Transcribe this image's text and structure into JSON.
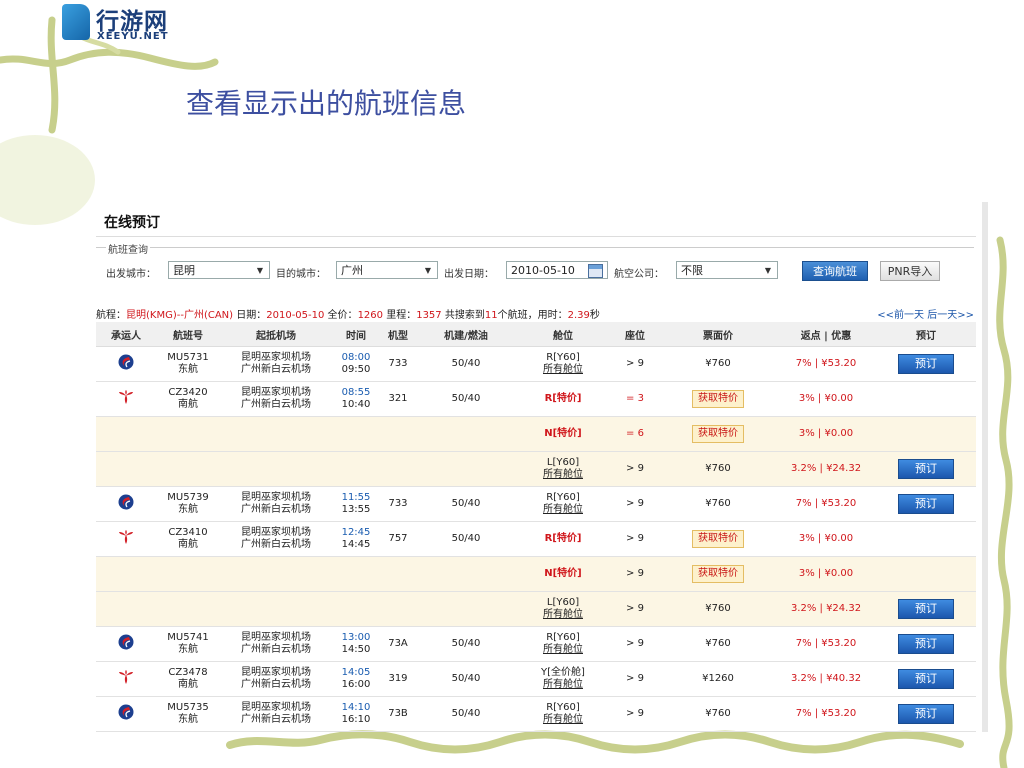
{
  "brand": {
    "name_cn": "行游网",
    "name_en": "XEEYU.NET"
  },
  "slide_title": "查看显示出的航班信息",
  "panel": {
    "title": "在线预订",
    "legend": "航班查询",
    "form": {
      "dep_label": "出发城市：",
      "dep_value": "昆明",
      "arr_label": "目的城市：",
      "arr_value": "广州",
      "date_label": "出发日期：",
      "date_value": "2010-05-10",
      "airline_label": "航空公司：",
      "airline_value": "不限",
      "search_btn": "查询航班",
      "pnr_btn": "PNR导入"
    },
    "info": {
      "p1": "航程：",
      "route": "昆明(KMG)--广州(CAN)",
      "p2": " 日期：",
      "date": "2010-05-10",
      "p3": " 全价：",
      "full": "1260",
      "p4": " 里程：",
      "miles": "1357",
      "p5": " 共搜索到",
      "count": "11",
      "p6": "个航班，用时：",
      "time": "2.39",
      "p7": "秒"
    },
    "daynav": "<<前一天  后一天>>",
    "headers": [
      "承运人",
      "航班号",
      "起抵机场",
      "时间",
      "机型",
      "机建/燃油",
      "舱位",
      "座位",
      "票面价",
      "返点 | 优惠",
      "预订"
    ],
    "rows": [
      {
        "sub": false,
        "carrier": "ce",
        "flight": "MU5731",
        "airline": "东航",
        "dep_ap": "昆明巫家坝机场",
        "arr_ap": "广州新白云机场",
        "dep_t": "08:00",
        "arr_t": "09:50",
        "plane": "733",
        "tax": "50/40",
        "cabin1": "R[Y60]",
        "cabin2": "所有舱位",
        "special": false,
        "seat": "> 9",
        "price": "¥760",
        "price_special": false,
        "rebate": "7% | ¥53.20",
        "book": "预订"
      },
      {
        "sub": false,
        "carrier": "cs",
        "flight": "CZ3420",
        "airline": "南航",
        "dep_ap": "昆明巫家坝机场",
        "arr_ap": "广州新白云机场",
        "dep_t": "08:55",
        "arr_t": "10:40",
        "plane": "321",
        "tax": "50/40",
        "cabin1": "R[特价]",
        "cabin2": "",
        "special": true,
        "seat": "= 3",
        "seat_red": true,
        "price": "获取特价",
        "price_special": true,
        "rebate": "3% | ¥0.00",
        "book": ""
      },
      {
        "sub": true,
        "carrier": "",
        "flight": "",
        "airline": "",
        "dep_ap": "",
        "arr_ap": "",
        "dep_t": "",
        "arr_t": "",
        "plane": "",
        "tax": "",
        "cabin1": "N[特价]",
        "cabin2": "",
        "special": true,
        "seat": "= 6",
        "seat_red": true,
        "price": "获取特价",
        "price_special": true,
        "rebate": "3% | ¥0.00",
        "book": ""
      },
      {
        "sub": true,
        "carrier": "",
        "flight": "",
        "airline": "",
        "dep_ap": "",
        "arr_ap": "",
        "dep_t": "",
        "arr_t": "",
        "plane": "",
        "tax": "",
        "cabin1": "L[Y60]",
        "cabin2": "所有舱位",
        "special": false,
        "seat": "> 9",
        "price": "¥760",
        "price_special": false,
        "rebate": "3.2% | ¥24.32",
        "book": "预订"
      },
      {
        "sub": false,
        "carrier": "ce",
        "flight": "MU5739",
        "airline": "东航",
        "dep_ap": "昆明巫家坝机场",
        "arr_ap": "广州新白云机场",
        "dep_t": "11:55",
        "arr_t": "13:55",
        "plane": "733",
        "tax": "50/40",
        "cabin1": "R[Y60]",
        "cabin2": "所有舱位",
        "special": false,
        "seat": "> 9",
        "price": "¥760",
        "price_special": false,
        "rebate": "7% | ¥53.20",
        "book": "预订"
      },
      {
        "sub": false,
        "carrier": "cs",
        "flight": "CZ3410",
        "airline": "南航",
        "dep_ap": "昆明巫家坝机场",
        "arr_ap": "广州新白云机场",
        "dep_t": "12:45",
        "arr_t": "14:45",
        "plane": "757",
        "tax": "50/40",
        "cabin1": "R[特价]",
        "cabin2": "",
        "special": true,
        "seat": "> 9",
        "price": "获取特价",
        "price_special": true,
        "rebate": "3% | ¥0.00",
        "book": ""
      },
      {
        "sub": true,
        "carrier": "",
        "flight": "",
        "airline": "",
        "dep_ap": "",
        "arr_ap": "",
        "dep_t": "",
        "arr_t": "",
        "plane": "",
        "tax": "",
        "cabin1": "N[特价]",
        "cabin2": "",
        "special": true,
        "seat": "> 9",
        "price": "获取特价",
        "price_special": true,
        "rebate": "3% | ¥0.00",
        "book": ""
      },
      {
        "sub": true,
        "carrier": "",
        "flight": "",
        "airline": "",
        "dep_ap": "",
        "arr_ap": "",
        "dep_t": "",
        "arr_t": "",
        "plane": "",
        "tax": "",
        "cabin1": "L[Y60]",
        "cabin2": "所有舱位",
        "special": false,
        "seat": "> 9",
        "price": "¥760",
        "price_special": false,
        "rebate": "3.2% | ¥24.32",
        "book": "预订"
      },
      {
        "sub": false,
        "carrier": "ce",
        "flight": "MU5741",
        "airline": "东航",
        "dep_ap": "昆明巫家坝机场",
        "arr_ap": "广州新白云机场",
        "dep_t": "13:00",
        "arr_t": "14:50",
        "plane": "73A",
        "tax": "50/40",
        "cabin1": "R[Y60]",
        "cabin2": "所有舱位",
        "special": false,
        "seat": "> 9",
        "price": "¥760",
        "price_special": false,
        "rebate": "7% | ¥53.20",
        "book": "预订"
      },
      {
        "sub": false,
        "carrier": "cs",
        "flight": "CZ3478",
        "airline": "南航",
        "dep_ap": "昆明巫家坝机场",
        "arr_ap": "广州新白云机场",
        "dep_t": "14:05",
        "arr_t": "16:00",
        "plane": "319",
        "tax": "50/40",
        "cabin1": "Y[全价舱]",
        "cabin2": "所有舱位",
        "special": false,
        "seat": "> 9",
        "price": "¥1260",
        "price_special": false,
        "rebate": "3.2% | ¥40.32",
        "book": "预订"
      },
      {
        "sub": false,
        "carrier": "ce",
        "flight": "MU5735",
        "airline": "东航",
        "dep_ap": "昆明巫家坝机场",
        "arr_ap": "广州新白云机场",
        "dep_t": "14:10",
        "arr_t": "16:10",
        "plane": "73B",
        "tax": "50/40",
        "cabin1": "R[Y60]",
        "cabin2": "所有舱位",
        "special": false,
        "seat": "> 9",
        "price": "¥760",
        "price_special": false,
        "rebate": "7% | ¥53.20",
        "book": "预订"
      }
    ]
  },
  "colors": {
    "accent": "#1a5cb0",
    "title": "#3d4fa0",
    "highlight_red": "#d0161b",
    "sub_row": "#fcf6e4"
  }
}
